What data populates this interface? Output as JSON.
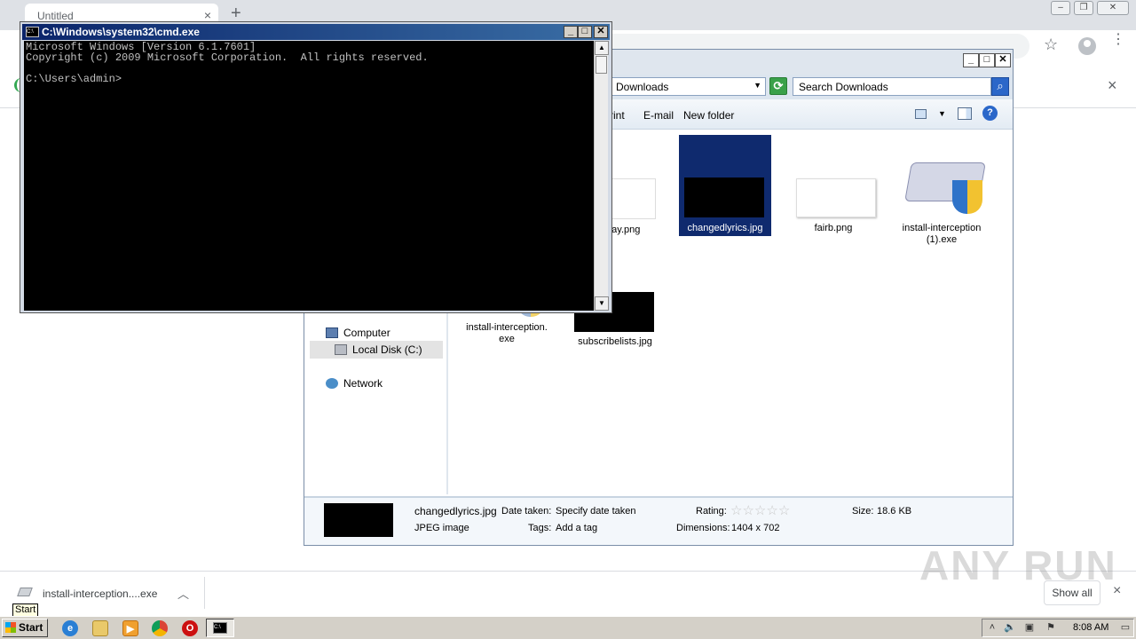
{
  "browser": {
    "tab_title": "Untitled",
    "tab_close": "×",
    "new_tab": "+",
    "infobar_close": "×",
    "star": "☆",
    "menu": "⋮"
  },
  "explorer": {
    "address": "Downloads",
    "search_placeholder": "Search Downloads",
    "commands": [
      "rint",
      "E-mail",
      "New folder"
    ],
    "nav": {
      "computer": "Computer",
      "local_disk": "Local Disk (C:)",
      "network": "Network"
    },
    "files": [
      {
        "name": "play.png"
      },
      {
        "name": "changedlyrics.jpg"
      },
      {
        "name": "fairb.png"
      },
      {
        "name": "install-interception (1).exe"
      },
      {
        "name": "install-interception. exe"
      },
      {
        "name": "subscribelists.jpg"
      }
    ],
    "details": {
      "filename": "changedlyrics.jpg",
      "filetype": "JPEG image",
      "date_taken_label": "Date taken:",
      "date_taken_value": "Specify date taken",
      "tags_label": "Tags:",
      "tags_value": "Add a tag",
      "rating_label": "Rating:",
      "dimensions_label": "Dimensions:",
      "dimensions_value": "1404 x 702",
      "size_label": "Size:",
      "size_value": "18.6 KB",
      "rating_stars": 0
    }
  },
  "cmd": {
    "title": "C:\\Windows\\system32\\cmd.exe",
    "lines": [
      "Microsoft Windows [Version 6.1.7601]",
      "Copyright (c) 2009 Microsoft Corporation.  All rights reserved.",
      "",
      "C:\\Users\\admin>"
    ]
  },
  "downloads": {
    "file_name": "install-interception....exe",
    "show_all": "Show all",
    "close": "×"
  },
  "watermark": "ANY RUN",
  "taskbar": {
    "start_label": "Start",
    "start_tooltip": "Start",
    "clock": "8:08 AM",
    "pinned": [
      "internet-explorer",
      "windows-explorer",
      "media-player",
      "chrome",
      "opera",
      "cmd"
    ]
  },
  "colors": {
    "cmd_title_gradient_start": "#0a246a",
    "selection": "#0f2a6e",
    "taskbar": "#d4d0c8"
  }
}
